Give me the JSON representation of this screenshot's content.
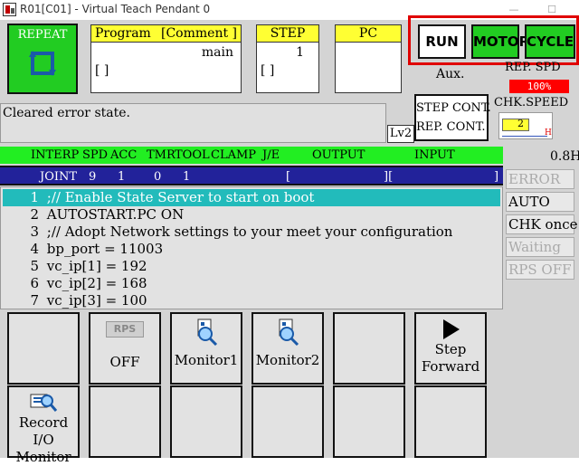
{
  "window": {
    "title": "R01[C01] - Virtual Teach Pendant 0",
    "minimize_glyph": "—",
    "maximize_glyph": "☐"
  },
  "mode": {
    "repeat_label": "REPEAT",
    "icon": "repeat-cycle-icon",
    "color": "#22cc22"
  },
  "program": {
    "header_left": "Program",
    "header_right": "[Comment ]",
    "name": "main",
    "bracket": "[                       ]"
  },
  "step": {
    "header": "STEP",
    "value": "1",
    "bracket": "[     ]"
  },
  "pc": {
    "header": "PC"
  },
  "toggles": {
    "run": "RUN",
    "motor": "MOTOR",
    "cycle": "CYCLE",
    "active_color": "#22cc22"
  },
  "aux": {
    "label": "Aux."
  },
  "speed": {
    "rep_spd_label": "REP. SPD",
    "rep_spd_value": "100%",
    "chk_speed_label": "CHK.SPEED",
    "chk_speed_value": "2",
    "chk_speed_end": "H"
  },
  "continuity": {
    "step_cont": "STEP CONT.",
    "rep_cont": "REP. CONT."
  },
  "message": {
    "text": "Cleared error state.",
    "level": "Lv2"
  },
  "interp": {
    "headers": {
      "interp": "INTERP",
      "spd": "SPD",
      "acc": "ACC",
      "tmr": "TMR",
      "tool": "TOOL",
      "clamp": "CLAMP",
      "je": "J/E",
      "output": "OUTPUT",
      "input": "INPUT"
    },
    "row": {
      "interp": "JOINT",
      "spd": "9",
      "acc": "1",
      "tmr": "0",
      "tool": "1",
      "output": "[",
      "input_left": "][",
      "input_right": "]"
    },
    "timer": "0.8H"
  },
  "program_lines": [
    {
      "n": "1",
      "text": ";// Enable State Server to start on boot"
    },
    {
      "n": "2",
      "text": "AUTOSTART.PC ON"
    },
    {
      "n": "3",
      "text": ";// Adopt Network settings to your meet your configuration"
    },
    {
      "n": "4",
      "text": "bp_port = 11003"
    },
    {
      "n": "5",
      "text": "vc_ip[1] = 192"
    },
    {
      "n": "6",
      "text": "vc_ip[2] = 168"
    },
    {
      "n": "7",
      "text": "vc_ip[3] = 100"
    }
  ],
  "status_side": {
    "error": "ERROR",
    "auto": "AUTO",
    "chk_once": "CHK once",
    "waiting": "Waiting",
    "rps_off": "RPS OFF"
  },
  "function_keys": {
    "rps_badge": "RPS",
    "rps_state": "OFF",
    "monitor1": "Monitor1",
    "monitor2": "Monitor2",
    "step_forward_1": "Step",
    "step_forward_2": "Forward",
    "record_io_1": "Record I/O",
    "record_io_2": "Monitor"
  }
}
